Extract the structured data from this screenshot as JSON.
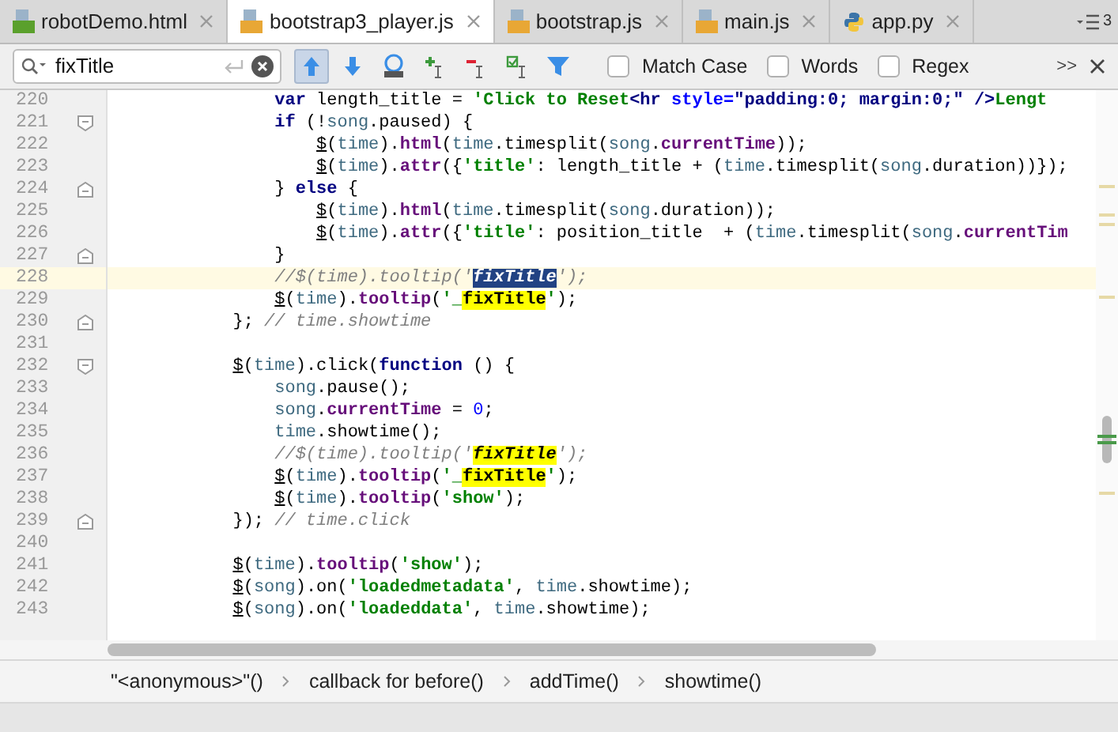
{
  "tabs": [
    {
      "label": "robotDemo.html",
      "kind": "html",
      "selected": false
    },
    {
      "label": "bootstrap3_player.js",
      "kind": "js",
      "selected": true
    },
    {
      "label": "bootstrap.js",
      "kind": "js",
      "selected": false
    },
    {
      "label": "main.js",
      "kind": "js",
      "selected": false
    },
    {
      "label": "app.py",
      "kind": "py",
      "selected": false
    }
  ],
  "tab_overflow": {
    "count": "3"
  },
  "find_bar": {
    "query": "fixTitle",
    "buttons": [
      {
        "kind": "up",
        "selected": true
      },
      {
        "kind": "down",
        "selected": false
      },
      {
        "kind": "all",
        "selected": false
      },
      {
        "kind": "add",
        "selected": false
      },
      {
        "kind": "remove",
        "selected": false
      },
      {
        "kind": "select",
        "selected": false
      },
      {
        "kind": "filter",
        "selected": false
      }
    ],
    "options": [
      {
        "label": "Match Case",
        "checked": false
      },
      {
        "label": "Words",
        "checked": false
      },
      {
        "label": "Regex",
        "checked": false
      }
    ],
    "more": ">>"
  },
  "editor": {
    "lines": [
      {
        "number": "220",
        "current": false,
        "tokens": [
          {
            "text": "                var",
            "kind": "kw"
          },
          {
            "text": " length_title = ",
            "kind": "plain"
          },
          {
            "text": "'Click to Reset",
            "kind": "str"
          },
          {
            "text": "<hr",
            "kind": "tag"
          },
          {
            "text": " style=",
            "kind": "attr"
          },
          {
            "text": "\"padding:0; margin:0;\"",
            "kind": "tag"
          },
          {
            "text": " />",
            "kind": "tag"
          },
          {
            "text": "Lengt",
            "kind": "str"
          }
        ]
      },
      {
        "number": "221",
        "current": false,
        "fold_marker": {
          "kind": "start"
        },
        "tokens": [
          {
            "text": "                if",
            "kind": "kw"
          },
          {
            "text": " (!",
            "kind": "plain"
          },
          {
            "text": "song",
            "kind": "var"
          },
          {
            "text": ".paused) {",
            "kind": "plain"
          }
        ]
      },
      {
        "number": "222",
        "current": false,
        "tokens": [
          {
            "text": "                    $",
            "kind": "dollar"
          },
          {
            "text": "(",
            "kind": "plain"
          },
          {
            "text": "time",
            "kind": "var"
          },
          {
            "text": ").",
            "kind": "plain"
          },
          {
            "text": "html",
            "kind": "fn"
          },
          {
            "text": "(",
            "kind": "plain"
          },
          {
            "text": "time",
            "kind": "var"
          },
          {
            "text": ".timesplit(",
            "kind": "plain"
          },
          {
            "text": "song",
            "kind": "var"
          },
          {
            "text": ".",
            "kind": "plain"
          },
          {
            "text": "currentTime",
            "kind": "fn"
          },
          {
            "text": "));",
            "kind": "plain"
          }
        ]
      },
      {
        "number": "223",
        "current": false,
        "tokens": [
          {
            "text": "                    $",
            "kind": "dollar"
          },
          {
            "text": "(",
            "kind": "plain"
          },
          {
            "text": "time",
            "kind": "var"
          },
          {
            "text": ").",
            "kind": "plain"
          },
          {
            "text": "attr",
            "kind": "fn"
          },
          {
            "text": "({",
            "kind": "plain"
          },
          {
            "text": "'title'",
            "kind": "str"
          },
          {
            "text": ": length_title + (",
            "kind": "plain"
          },
          {
            "text": "time",
            "kind": "var"
          },
          {
            "text": ".timesplit(",
            "kind": "plain"
          },
          {
            "text": "song",
            "kind": "var"
          },
          {
            "text": ".duration))});",
            "kind": "plain"
          }
        ]
      },
      {
        "number": "224",
        "current": false,
        "fold_marker": {
          "kind": "end"
        },
        "tokens": [
          {
            "text": "                } ",
            "kind": "plain"
          },
          {
            "text": "else",
            "kind": "kw"
          },
          {
            "text": " {",
            "kind": "plain"
          }
        ]
      },
      {
        "number": "225",
        "current": false,
        "tokens": [
          {
            "text": "                    $",
            "kind": "dollar"
          },
          {
            "text": "(",
            "kind": "plain"
          },
          {
            "text": "time",
            "kind": "var"
          },
          {
            "text": ").",
            "kind": "plain"
          },
          {
            "text": "html",
            "kind": "fn"
          },
          {
            "text": "(",
            "kind": "plain"
          },
          {
            "text": "time",
            "kind": "var"
          },
          {
            "text": ".timesplit(",
            "kind": "plain"
          },
          {
            "text": "song",
            "kind": "var"
          },
          {
            "text": ".duration));",
            "kind": "plain"
          }
        ]
      },
      {
        "number": "226",
        "current": false,
        "tokens": [
          {
            "text": "                    $",
            "kind": "dollar"
          },
          {
            "text": "(",
            "kind": "plain"
          },
          {
            "text": "time",
            "kind": "var"
          },
          {
            "text": ").",
            "kind": "plain"
          },
          {
            "text": "attr",
            "kind": "fn"
          },
          {
            "text": "({",
            "kind": "plain"
          },
          {
            "text": "'title'",
            "kind": "str"
          },
          {
            "text": ": position_title  + (",
            "kind": "plain"
          },
          {
            "text": "time",
            "kind": "var"
          },
          {
            "text": ".timesplit(",
            "kind": "plain"
          },
          {
            "text": "song",
            "kind": "var"
          },
          {
            "text": ".",
            "kind": "plain"
          },
          {
            "text": "currentTim",
            "kind": "fn"
          }
        ]
      },
      {
        "number": "227",
        "current": false,
        "fold_marker": {
          "kind": "end"
        },
        "tokens": [
          {
            "text": "                }",
            "kind": "plain"
          }
        ]
      },
      {
        "number": "228",
        "current": true,
        "tokens": [
          {
            "text": "                //$(time).tooltip('",
            "kind": "cmt"
          },
          {
            "text": "fixTitle",
            "kind": "cmatch",
            "selected": true
          },
          {
            "text": "');",
            "kind": "cmt"
          }
        ]
      },
      {
        "number": "229",
        "current": false,
        "tokens": [
          {
            "text": "                $",
            "kind": "dollar"
          },
          {
            "text": "(",
            "kind": "plain"
          },
          {
            "text": "time",
            "kind": "var"
          },
          {
            "text": ").",
            "kind": "plain"
          },
          {
            "text": "tooltip",
            "kind": "fn"
          },
          {
            "text": "(",
            "kind": "plain"
          },
          {
            "text": "'_",
            "kind": "str"
          },
          {
            "text": "fixTitle",
            "kind": "match",
            "selected": false
          },
          {
            "text": "'",
            "kind": "str"
          },
          {
            "text": ");",
            "kind": "plain"
          }
        ]
      },
      {
        "number": "230",
        "current": false,
        "fold_marker": {
          "kind": "end"
        },
        "tokens": [
          {
            "text": "            }; ",
            "kind": "plain"
          },
          {
            "text": "// time.showtime",
            "kind": "cmt"
          }
        ]
      },
      {
        "number": "231",
        "current": false
      },
      {
        "number": "232",
        "current": false,
        "fold_marker": {
          "kind": "start"
        },
        "tokens": [
          {
            "text": "            $",
            "kind": "dollar"
          },
          {
            "text": "(",
            "kind": "plain"
          },
          {
            "text": "time",
            "kind": "var"
          },
          {
            "text": ").click(",
            "kind": "plain"
          },
          {
            "text": "function",
            "kind": "kw"
          },
          {
            "text": " () {",
            "kind": "plain"
          }
        ]
      },
      {
        "number": "233",
        "current": false,
        "tokens": [
          {
            "text": "                song",
            "kind": "var"
          },
          {
            "text": ".pause();",
            "kind": "plain"
          }
        ]
      },
      {
        "number": "234",
        "current": false,
        "tokens": [
          {
            "text": "                song",
            "kind": "var"
          },
          {
            "text": ".",
            "kind": "plain"
          },
          {
            "text": "currentTime",
            "kind": "fn"
          },
          {
            "text": " = ",
            "kind": "plain"
          },
          {
            "text": "0",
            "kind": "num"
          },
          {
            "text": ";",
            "kind": "plain"
          }
        ]
      },
      {
        "number": "235",
        "current": false,
        "tokens": [
          {
            "text": "                time",
            "kind": "var"
          },
          {
            "text": ".showtime();",
            "kind": "plain"
          }
        ]
      },
      {
        "number": "236",
        "current": false,
        "tokens": [
          {
            "text": "                //$(time).tooltip('",
            "kind": "cmt"
          },
          {
            "text": "fixTitle",
            "kind": "cmatch",
            "selected": false
          },
          {
            "text": "');",
            "kind": "cmt"
          }
        ]
      },
      {
        "number": "237",
        "current": false,
        "tokens": [
          {
            "text": "                $",
            "kind": "dollar"
          },
          {
            "text": "(",
            "kind": "plain"
          },
          {
            "text": "time",
            "kind": "var"
          },
          {
            "text": ").",
            "kind": "plain"
          },
          {
            "text": "tooltip",
            "kind": "fn"
          },
          {
            "text": "(",
            "kind": "plain"
          },
          {
            "text": "'_",
            "kind": "str"
          },
          {
            "text": "fixTitle",
            "kind": "match",
            "selected": false
          },
          {
            "text": "'",
            "kind": "str"
          },
          {
            "text": ");",
            "kind": "plain"
          }
        ]
      },
      {
        "number": "238",
        "current": false,
        "tokens": [
          {
            "text": "                $",
            "kind": "dollar"
          },
          {
            "text": "(",
            "kind": "plain"
          },
          {
            "text": "time",
            "kind": "var"
          },
          {
            "text": ").",
            "kind": "plain"
          },
          {
            "text": "tooltip",
            "kind": "fn"
          },
          {
            "text": "(",
            "kind": "plain"
          },
          {
            "text": "'show'",
            "kind": "str"
          },
          {
            "text": ");",
            "kind": "plain"
          }
        ]
      },
      {
        "number": "239",
        "current": false,
        "fold_marker": {
          "kind": "end"
        },
        "tokens": [
          {
            "text": "            }); ",
            "kind": "plain"
          },
          {
            "text": "// time.click",
            "kind": "cmt"
          }
        ]
      },
      {
        "number": "240",
        "current": false
      },
      {
        "number": "241",
        "current": false,
        "tokens": [
          {
            "text": "            $",
            "kind": "dollar"
          },
          {
            "text": "(",
            "kind": "plain"
          },
          {
            "text": "time",
            "kind": "var"
          },
          {
            "text": ").",
            "kind": "plain"
          },
          {
            "text": "tooltip",
            "kind": "fn"
          },
          {
            "text": "(",
            "kind": "plain"
          },
          {
            "text": "'show'",
            "kind": "str"
          },
          {
            "text": ");",
            "kind": "plain"
          }
        ]
      },
      {
        "number": "242",
        "current": false,
        "tokens": [
          {
            "text": "            $",
            "kind": "dollar"
          },
          {
            "text": "(",
            "kind": "plain"
          },
          {
            "text": "song",
            "kind": "var"
          },
          {
            "text": ").on(",
            "kind": "plain"
          },
          {
            "text": "'loadedmetadata'",
            "kind": "str"
          },
          {
            "text": ", ",
            "kind": "plain"
          },
          {
            "text": "time",
            "kind": "var"
          },
          {
            "text": ".showtime);",
            "kind": "plain"
          }
        ]
      },
      {
        "number": "243",
        "current": false,
        "tokens": [
          {
            "text": "            $",
            "kind": "dollar"
          },
          {
            "text": "(",
            "kind": "plain"
          },
          {
            "text": "song",
            "kind": "var"
          },
          {
            "text": ").on(",
            "kind": "plain"
          },
          {
            "text": "'loadeddata'",
            "kind": "str"
          },
          {
            "text": ", ",
            "kind": "plain"
          },
          {
            "text": "time",
            "kind": "var"
          },
          {
            "text": ".showtime);",
            "kind": "plain"
          }
        ]
      }
    ]
  },
  "breadcrumbs": [
    "\"<anonymous>\"()",
    "callback for before()",
    "addTime()",
    "showtime()"
  ]
}
